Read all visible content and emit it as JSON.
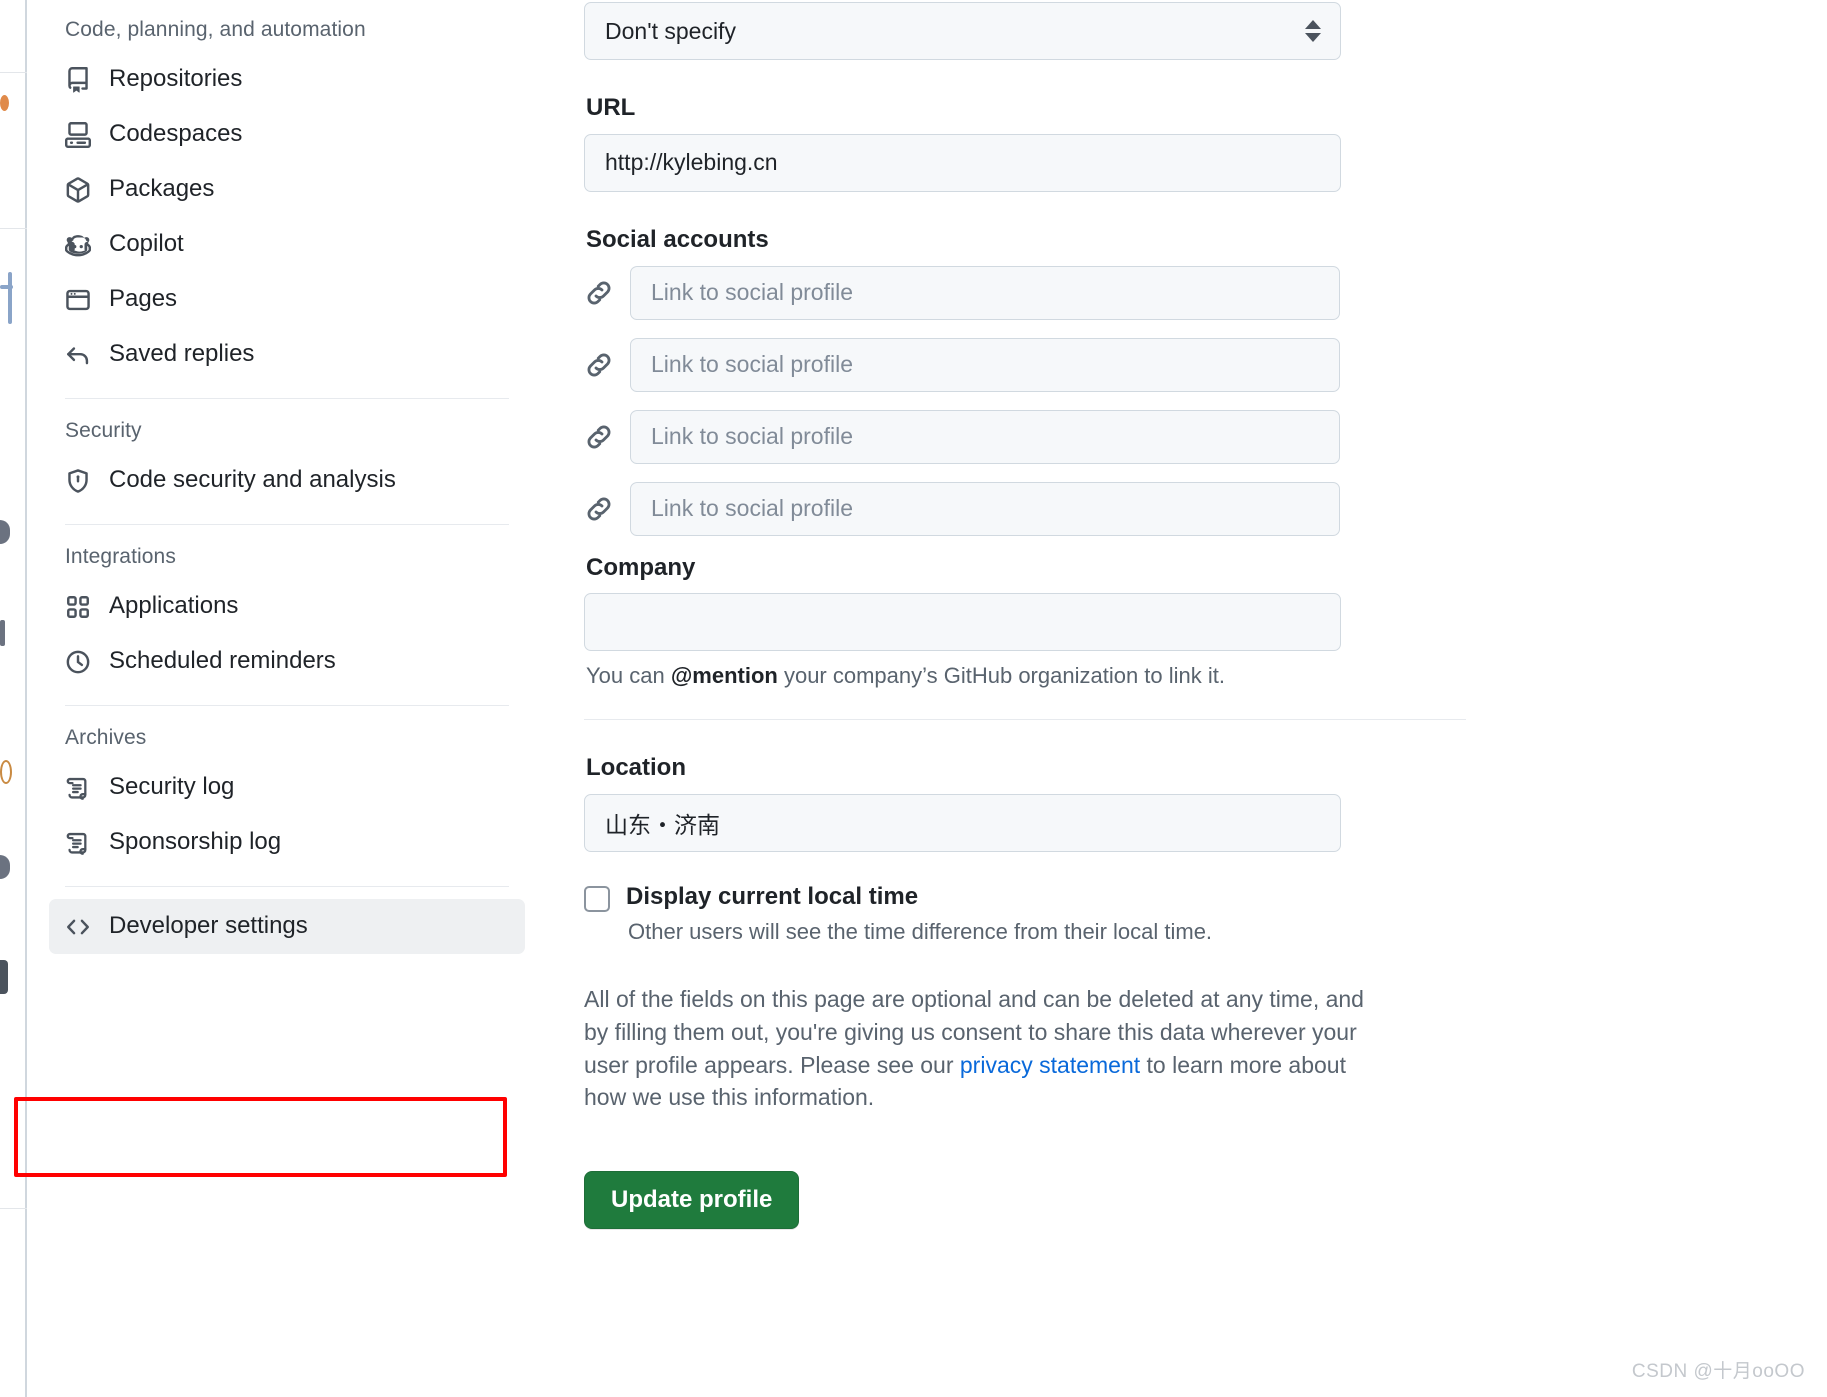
{
  "sidebar": {
    "groups": [
      {
        "title": "Code, planning, and automation",
        "items": [
          {
            "label": "Repositories",
            "icon": "repo-icon"
          },
          {
            "label": "Codespaces",
            "icon": "codespaces-icon"
          },
          {
            "label": "Packages",
            "icon": "package-icon"
          },
          {
            "label": "Copilot",
            "icon": "copilot-icon"
          },
          {
            "label": "Pages",
            "icon": "pages-icon"
          },
          {
            "label": "Saved replies",
            "icon": "reply-icon"
          }
        ]
      },
      {
        "title": "Security",
        "items": [
          {
            "label": "Code security and analysis",
            "icon": "shield-lock-icon"
          }
        ]
      },
      {
        "title": "Integrations",
        "items": [
          {
            "label": "Applications",
            "icon": "apps-grid-icon"
          },
          {
            "label": "Scheduled reminders",
            "icon": "clock-icon"
          }
        ]
      },
      {
        "title": "Archives",
        "items": [
          {
            "label": "Security log",
            "icon": "log-scroll-icon"
          },
          {
            "label": "Sponsorship log",
            "icon": "log-scroll-icon"
          }
        ]
      }
    ],
    "developer_settings": {
      "label": "Developer settings",
      "icon": "code-brackets-icon",
      "selected": true
    }
  },
  "form": {
    "pronouns_select": {
      "value": "Don't specify",
      "icon": "select-arrows-icon"
    },
    "url": {
      "label": "URL",
      "value": "http://kylebing.cn"
    },
    "social": {
      "label": "Social accounts",
      "icon": "link-icon",
      "placeholder": "Link to social profile",
      "inputs": [
        "",
        "",
        "",
        ""
      ]
    },
    "company": {
      "label": "Company",
      "value": "",
      "help_prefix": "You can ",
      "help_mention": "@mention",
      "help_suffix": " your company’s GitHub organization to link it."
    },
    "location": {
      "label": "Location",
      "value": "山东・济南"
    },
    "local_time": {
      "label": "Display current local time",
      "checked": false,
      "sub": "Other users will see the time difference from their local time."
    },
    "disclaimer": {
      "part1": "All of the fields on this page are optional and can be deleted at any time, and by filling them out, you're giving us consent to share this data wherever your user profile appears. Please see our ",
      "link": "privacy statement",
      "part2": " to learn more about how we use this information."
    },
    "submit": {
      "label": "Update profile"
    }
  },
  "watermark": {
    "text": "CSDN @十月ooOO"
  },
  "colors": {
    "accent_green": "#1f7b3d",
    "link_blue": "#0969da",
    "annotation_red": "#ff0000",
    "input_bg": "#f6f8fa",
    "selected_bg": "#eef0f2"
  }
}
